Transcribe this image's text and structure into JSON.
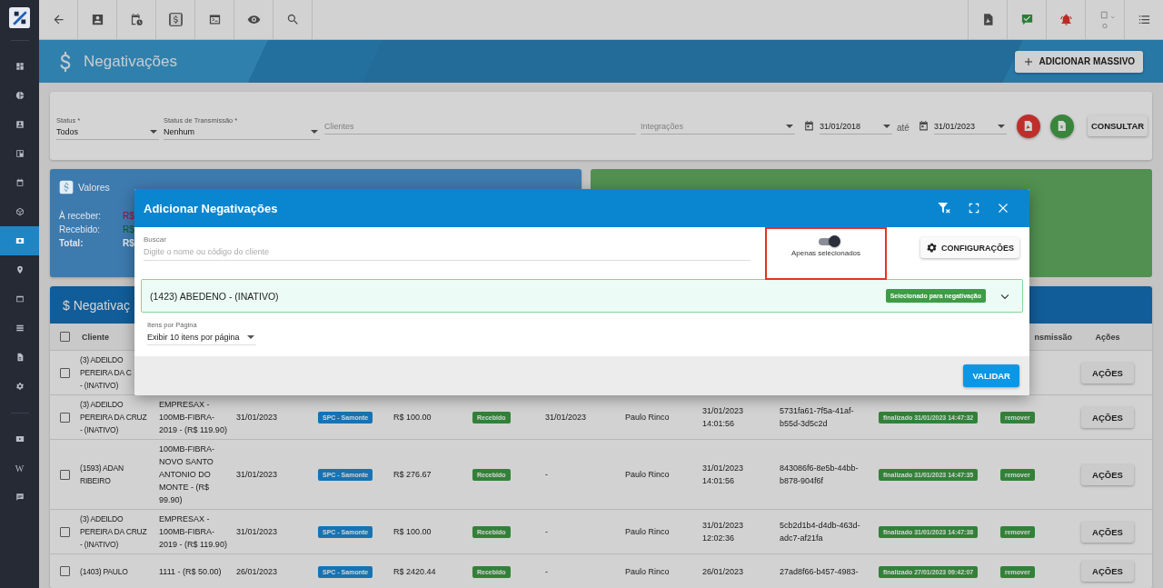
{
  "sidebar": {
    "groups": [
      [
        {
          "selected": false
        },
        {
          "selected": false
        },
        {
          "selected": false
        },
        {
          "selected": false
        },
        {
          "selected": false
        },
        {
          "selected": false
        },
        {
          "selected": true
        },
        {
          "selected": false
        },
        {
          "selected": false
        },
        {
          "selected": false
        },
        {
          "selected": false
        },
        {
          "selected": false
        }
      ],
      [
        {
          "selected": false
        },
        {
          "selected": false,
          "label": "W"
        },
        {
          "selected": false
        }
      ]
    ]
  },
  "header": {
    "title": "Negativações",
    "add_button": "ADICIONAR MASSIVO"
  },
  "filters": {
    "status": {
      "label": "Status *",
      "value": "Todos"
    },
    "transmission": {
      "label": "Status de Transmissão *",
      "value": "Nenhum"
    },
    "clients": {
      "placeholder": "Clientes"
    },
    "integrations": {
      "placeholder": "Integrações"
    },
    "date_from": "31/01/2018",
    "separator": "até",
    "date_to": "31/01/2023",
    "query_button": "CONSULTAR"
  },
  "values_card": {
    "title": "Valores",
    "rows": [
      {
        "label": "À receber:",
        "value": "R$",
        "color": "#9b1030",
        "emphasis": false
      },
      {
        "label": "Recebido:",
        "value": "R$",
        "color": "#0d5c22",
        "emphasis": false
      },
      {
        "label": "Total:",
        "value": "R$",
        "emphasis": true
      }
    ]
  },
  "table": {
    "title": "$ Negativaç",
    "header": {
      "select_all": false,
      "client": "Cliente",
      "column_13": "nsmissão",
      "actions": "Ações"
    },
    "rows": [
      {
        "selected": false,
        "client": "(3) ADEILDO\nPEREIRA DA C\n- (INATIVO)",
        "action": "AÇÕES"
      },
      {
        "selected": false,
        "client": "(3) ADEILDO PEREIRA DA CRUZ - (INATIVO)",
        "contract": "EMPRESAX - 100MB-FIBRA-2019 - (R$ 119.90)",
        "date": "31/01/2023",
        "integration": "SPC - Samonte",
        "amount": "R$ 100.00",
        "status": "Recebido",
        "received_date": "31/01/2023",
        "user": "Paulo Rinco",
        "sent_at": "31/01/2023 14:01:56",
        "protocol": "5731fa61-7f5a-41af-b55d-3d5c2d",
        "transmission": "finalizado 31/01/2023 14:47:32",
        "remove": "remover",
        "action": "AÇÕES"
      },
      {
        "selected": false,
        "client": "(1593) ADAN RIBEIRO",
        "contract": "100MB-FIBRA-NOVO SANTO ANTONIO DO MONTE - (R$ 99.90)",
        "date": "31/01/2023",
        "integration": "SPC - Samonte",
        "amount": "R$ 276.67",
        "status": "Recebido",
        "received_date": "-",
        "user": "Paulo Rinco",
        "sent_at": "31/01/2023 14:01:56",
        "protocol": "843086f6-8e5b-44bb-b878-904f6f",
        "transmission": "finalizado 31/01/2023 14:47:35",
        "remove": "remover",
        "action": "AÇÕES"
      },
      {
        "selected": false,
        "client": "(3) ADEILDO PEREIRA DA CRUZ - (INATIVO)",
        "contract": "EMPRESAX - 100MB-FIBRA-2019 - (R$ 119.90)",
        "date": "31/01/2023",
        "integration": "SPC - Samonte",
        "amount": "R$ 100.00",
        "status": "Recebido",
        "received_date": "-",
        "user": "Paulo Rinco",
        "sent_at": "31/01/2023 12:02:36",
        "protocol": "5cb2d1b4-d4db-463d-adc7-af21fa",
        "transmission": "finalizado 31/01/2023 14:47:38",
        "remove": "remover",
        "action": "AÇÕES"
      },
      {
        "selected": false,
        "client": "(1403) PAULO",
        "contract": "1111 - (R$ 50.00)",
        "date": "26/01/2023",
        "integration": "SPC - Samonte",
        "amount": "R$ 2420.44",
        "status": "Recebido",
        "received_date": "-",
        "user": "Paulo Rinco",
        "sent_at": "26/01/2023",
        "protocol": "27ad8f66-b457-4983-",
        "transmission": "finalizado 27/01/2023 09:42:07",
        "remove": "remover",
        "action": "AÇÕES"
      }
    ]
  },
  "modal": {
    "title": "Adicionar Negativações",
    "search": {
      "label": "Buscar",
      "placeholder": "Digite o nome ou código do cliente"
    },
    "only_selected": {
      "label": "Apenas selecionados",
      "on": true
    },
    "settings_button": "CONFIGURAÇÕES",
    "clients": [
      {
        "name": "(1423) ABEDENO - (INATIVO)",
        "badge": "Selecionado para negativação",
        "expanded": false
      }
    ],
    "page_size": {
      "label": "Itens por Página",
      "value": "Exibir 10 itens por página"
    },
    "validate_button": "VALIDAR"
  }
}
